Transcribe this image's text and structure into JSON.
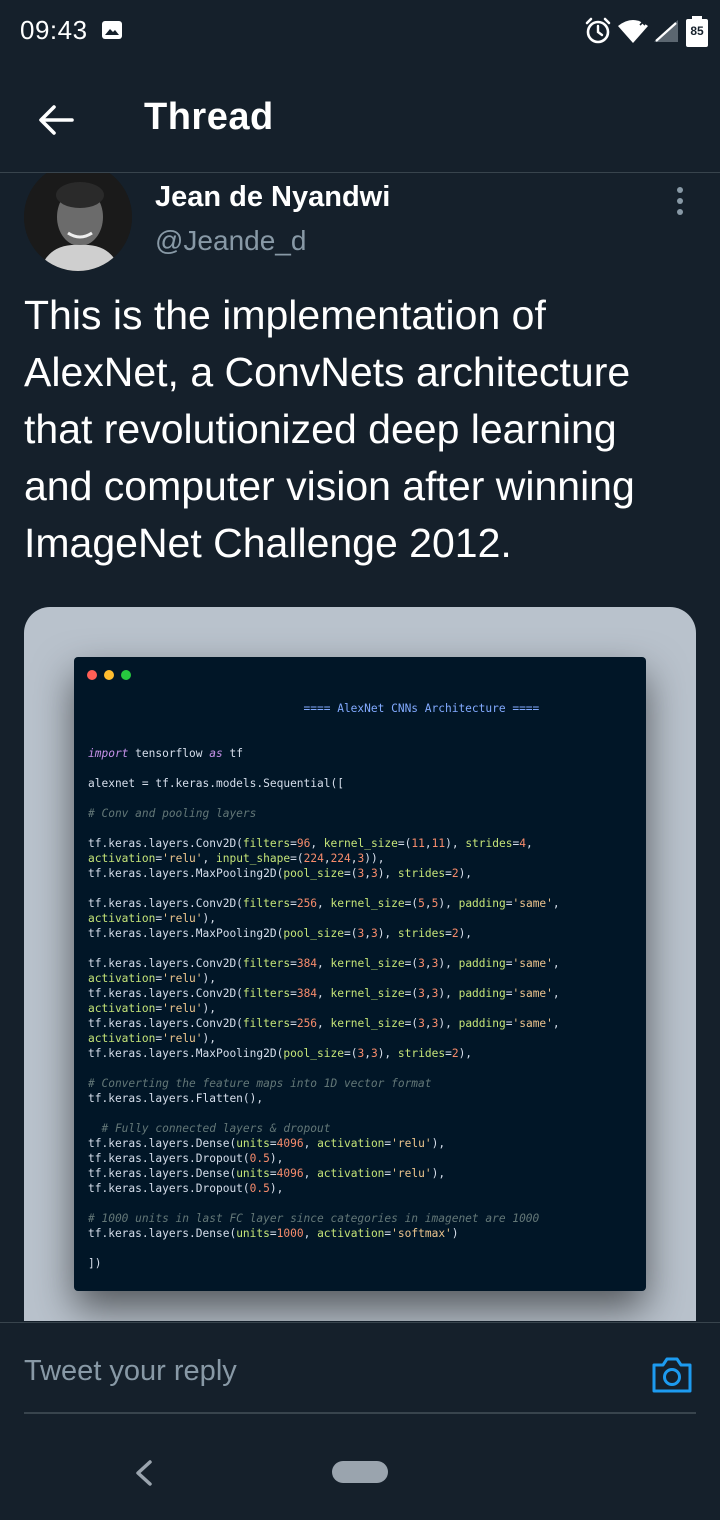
{
  "status_bar": {
    "time": "09:43",
    "battery": "85",
    "icons": [
      "image-notification-icon",
      "alarm-icon",
      "wifi-icon",
      "signal-icon",
      "battery-icon"
    ]
  },
  "header": {
    "title": "Thread",
    "back_icon": "arrow-left-icon"
  },
  "tweet": {
    "author_name": "Jean de Nyandwi",
    "author_handle": "@Jeande_d",
    "text": "This is the implementation of AlexNet, a ConvNets architecture that revolutionized deep learning and computer vision after winning ImageNet Challenge 2012.",
    "more_icon": "more-vertical-icon"
  },
  "code_image": {
    "lines": [
      "                                ==== AlexNet CNNs Architecture ====",
      "",
      "",
      "import tensorflow as tf",
      "",
      "alexnet = tf.keras.models.Sequential([",
      "",
      "# Conv and pooling layers",
      "",
      "tf.keras.layers.Conv2D(filters=96, kernel_size=(11,11), strides=4,",
      "activation='relu', input_shape=(224,224,3)),",
      "tf.keras.layers.MaxPooling2D(pool_size=(3,3), strides=2),",
      "",
      "tf.keras.layers.Conv2D(filters=256, kernel_size=(5,5), padding='same',",
      "activation='relu'),",
      "tf.keras.layers.MaxPooling2D(pool_size=(3,3), strides=2),",
      "",
      "tf.keras.layers.Conv2D(filters=384, kernel_size=(3,3), padding='same',",
      "activation='relu'),",
      "tf.keras.layers.Conv2D(filters=384, kernel_size=(3,3), padding='same',",
      "activation='relu'),",
      "tf.keras.layers.Conv2D(filters=256, kernel_size=(3,3), padding='same',",
      "activation='relu'),",
      "tf.keras.layers.MaxPooling2D(pool_size=(3,3), strides=2),",
      "",
      "# Converting the feature maps into 1D vector format",
      "tf.keras.layers.Flatten(),",
      "",
      "  # Fully connected layers & dropout",
      "tf.keras.layers.Dense(units=4096, activation='relu'),",
      "tf.keras.layers.Dropout(0.5),",
      "tf.keras.layers.Dense(units=4096, activation='relu'),",
      "tf.keras.layers.Dropout(0.5),",
      "",
      "# 1000 units in last FC layer since categories in imagenet are 1000",
      "tf.keras.layers.Dense(units=1000, activation='softmax')",
      "",
      "])"
    ],
    "colors": {
      "background": "#011627",
      "card": "#b9c2cc"
    }
  },
  "reply": {
    "placeholder": "Tweet your reply",
    "camera_icon": "camera-icon"
  },
  "colors": {
    "background": "#15202b",
    "accent": "#1d9bf0",
    "secondary_text": "#8899a6",
    "divider": "#38444d"
  }
}
